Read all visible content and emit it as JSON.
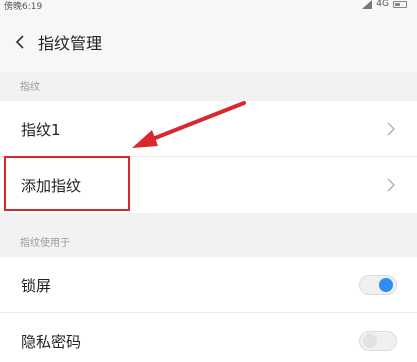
{
  "status_bar": {
    "time": "傍晚6:19",
    "network": "4G"
  },
  "header": {
    "title": "指纹管理"
  },
  "sections": {
    "fingerprints_label": "指纹",
    "usage_label": "指纹使用于"
  },
  "rows": {
    "fingerprint1": "指纹1",
    "add_fingerprint": "添加指纹",
    "lock_screen": "锁屏",
    "privacy_password": "隐私密码"
  },
  "toggles": {
    "lock_screen_on": true,
    "privacy_password_on": false
  },
  "colors": {
    "accent": "#2f8cf1",
    "highlight": "#d9272e"
  }
}
